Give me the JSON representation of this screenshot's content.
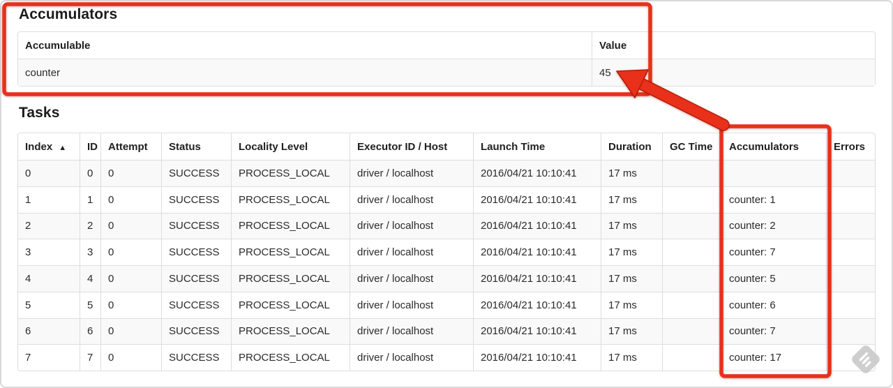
{
  "annotation": {
    "color": "#e8301a",
    "outline_color": "#b81d05"
  },
  "accumulators_section": {
    "heading": "Accumulators",
    "table": {
      "headers": [
        "Accumulable",
        "Value"
      ],
      "rows": [
        [
          "counter",
          "45"
        ]
      ]
    }
  },
  "tasks_section": {
    "heading": "Tasks",
    "table": {
      "headers": [
        "Index",
        "ID",
        "Attempt",
        "Status",
        "Locality Level",
        "Executor ID / Host",
        "Launch Time",
        "Duration",
        "GC Time",
        "Accumulators",
        "Errors"
      ],
      "sorted_column": "Index",
      "sort_indicator": "▲",
      "rows": [
        [
          "0",
          "0",
          "0",
          "SUCCESS",
          "PROCESS_LOCAL",
          "driver / localhost",
          "2016/04/21 10:10:41",
          "17 ms",
          "",
          "",
          ""
        ],
        [
          "1",
          "1",
          "0",
          "SUCCESS",
          "PROCESS_LOCAL",
          "driver / localhost",
          "2016/04/21 10:10:41",
          "17 ms",
          "",
          "counter: 1",
          ""
        ],
        [
          "2",
          "2",
          "0",
          "SUCCESS",
          "PROCESS_LOCAL",
          "driver / localhost",
          "2016/04/21 10:10:41",
          "17 ms",
          "",
          "counter: 2",
          ""
        ],
        [
          "3",
          "3",
          "0",
          "SUCCESS",
          "PROCESS_LOCAL",
          "driver / localhost",
          "2016/04/21 10:10:41",
          "17 ms",
          "",
          "counter: 7",
          ""
        ],
        [
          "4",
          "4",
          "0",
          "SUCCESS",
          "PROCESS_LOCAL",
          "driver / localhost",
          "2016/04/21 10:10:41",
          "17 ms",
          "",
          "counter: 5",
          ""
        ],
        [
          "5",
          "5",
          "0",
          "SUCCESS",
          "PROCESS_LOCAL",
          "driver / localhost",
          "2016/04/21 10:10:41",
          "17 ms",
          "",
          "counter: 6",
          ""
        ],
        [
          "6",
          "6",
          "0",
          "SUCCESS",
          "PROCESS_LOCAL",
          "driver / localhost",
          "2016/04/21 10:10:41",
          "17 ms",
          "",
          "counter: 7",
          ""
        ],
        [
          "7",
          "7",
          "0",
          "SUCCESS",
          "PROCESS_LOCAL",
          "driver / localhost",
          "2016/04/21 10:10:41",
          "17 ms",
          "",
          "counter: 17",
          ""
        ]
      ]
    }
  },
  "watermark": {
    "icon_gray": "#cacaca"
  }
}
